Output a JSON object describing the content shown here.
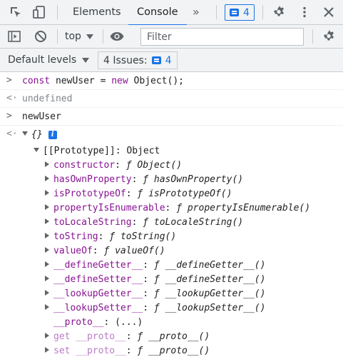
{
  "tabs": {
    "elements": "Elements",
    "console": "Console",
    "more": "»",
    "issues_count": "4"
  },
  "toolbar": {
    "context": "top",
    "filter_placeholder": "Filter"
  },
  "levels": {
    "label": "Default levels",
    "issues_label": "4 Issues:",
    "issues_count": "4"
  },
  "console": {
    "cmd1": {
      "kw_const": "const",
      "mid": " newUser = ",
      "kw_new": "new",
      "tail": " Object();"
    },
    "result1": "undefined",
    "cmd2": "newUser",
    "result2": "{}",
    "prototype_label": "[[Prototype]]: Object",
    "props": [
      {
        "name": "constructor",
        "sym": "ƒ",
        "value": "Object()"
      },
      {
        "name": "hasOwnProperty",
        "sym": "ƒ",
        "value": "hasOwnProperty()"
      },
      {
        "name": "isPrototypeOf",
        "sym": "ƒ",
        "value": "isPrototypeOf()"
      },
      {
        "name": "propertyIsEnumerable",
        "sym": "ƒ",
        "value": "propertyIsEnumerable()"
      },
      {
        "name": "toLocaleString",
        "sym": "ƒ",
        "value": "toLocaleString()"
      },
      {
        "name": "toString",
        "sym": "ƒ",
        "value": "toString()"
      },
      {
        "name": "valueOf",
        "sym": "ƒ",
        "value": "valueOf()"
      },
      {
        "name": "__defineGetter__",
        "sym": "ƒ",
        "value": "__defineGetter__()"
      },
      {
        "name": "__defineSetter__",
        "sym": "ƒ",
        "value": "__defineSetter__()"
      },
      {
        "name": "__lookupGetter__",
        "sym": "ƒ",
        "value": "__lookupGetter__()"
      },
      {
        "name": "__lookupSetter__",
        "sym": "ƒ",
        "value": "__lookupSetter__()"
      }
    ],
    "proto_getter": {
      "name": "__proto__",
      "value": "(...)"
    },
    "accessors": [
      {
        "name": "get __proto__",
        "sym": "ƒ",
        "value": "__proto__()"
      },
      {
        "name": "set __proto__",
        "sym": "ƒ",
        "value": "__proto__()"
      }
    ]
  }
}
